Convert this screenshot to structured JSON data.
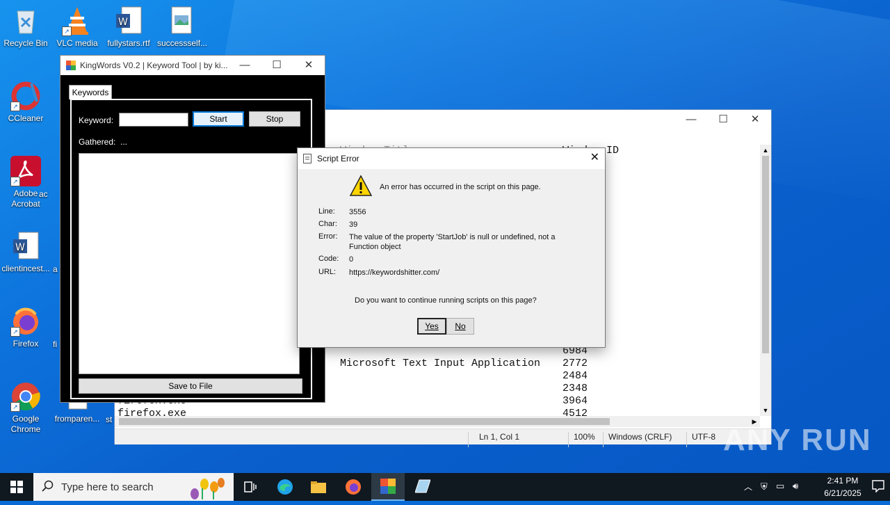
{
  "desktop": {
    "icons": [
      {
        "label": "Recycle Bin"
      },
      {
        "label": "VLC media"
      },
      {
        "label": "fullystars.rtf"
      },
      {
        "label": "successself..."
      },
      {
        "label": "CCleaner"
      },
      {
        "label": "Adobe Acrobat"
      },
      {
        "label": "clientincest..."
      },
      {
        "label": "Firefox"
      },
      {
        "label": "Google Chrome"
      },
      {
        "label": "fromparen..."
      }
    ],
    "partial_labels": [
      "ac",
      "a",
      "fi",
      "st"
    ]
  },
  "notepad": {
    "header_partial_left": "Window Title",
    "header_partial_right": "Window ID",
    "lines": [
      {
        "name": "",
        "pid": "6984"
      },
      {
        "name": "Microsoft Text Input Application",
        "pid": "2772"
      },
      {
        "name": "",
        "pid": "2484"
      },
      {
        "name": "",
        "pid": "2348"
      },
      {
        "name": "firefox.exe",
        "pid": "3964"
      },
      {
        "name": "firefox.exe",
        "pid": "4512"
      }
    ],
    "status": {
      "position": "Ln 1, Col 1",
      "zoom": "100%",
      "line_ending": "Windows (CRLF)",
      "encoding": "UTF-8"
    }
  },
  "kingwords": {
    "title": "KingWords V0.2 | Keyword Tool | by ki...",
    "tab": "Keywords",
    "keyword_label": "Keyword:",
    "keyword_value": "",
    "start_label": "Start",
    "stop_label": "Stop",
    "gathered_label": "Gathered:",
    "gathered_value": "...",
    "save_label": "Save to File"
  },
  "dialog": {
    "title": "Script Error",
    "message": "An error has occurred in the script on this page.",
    "line_label": "Line:",
    "line_value": "3556",
    "char_label": "Char:",
    "char_value": "39",
    "error_label": "Error:",
    "error_value": "The value of the property 'StartJob' is null or undefined, not a Function object",
    "code_label": "Code:",
    "code_value": "0",
    "url_label": "URL:",
    "url_value": "https://keywordshitter.com/",
    "question": "Do you want to continue running scripts on this page?",
    "yes_label": "Yes",
    "no_label": "No"
  },
  "taskbar": {
    "search_placeholder": "Type here to search",
    "time": "2:41 PM",
    "date": "6/21/2025"
  },
  "watermark": "ANY RUN",
  "colors": {
    "desktop": "#0d72dc",
    "taskbar": "#101820",
    "accent": "#0078d7"
  }
}
